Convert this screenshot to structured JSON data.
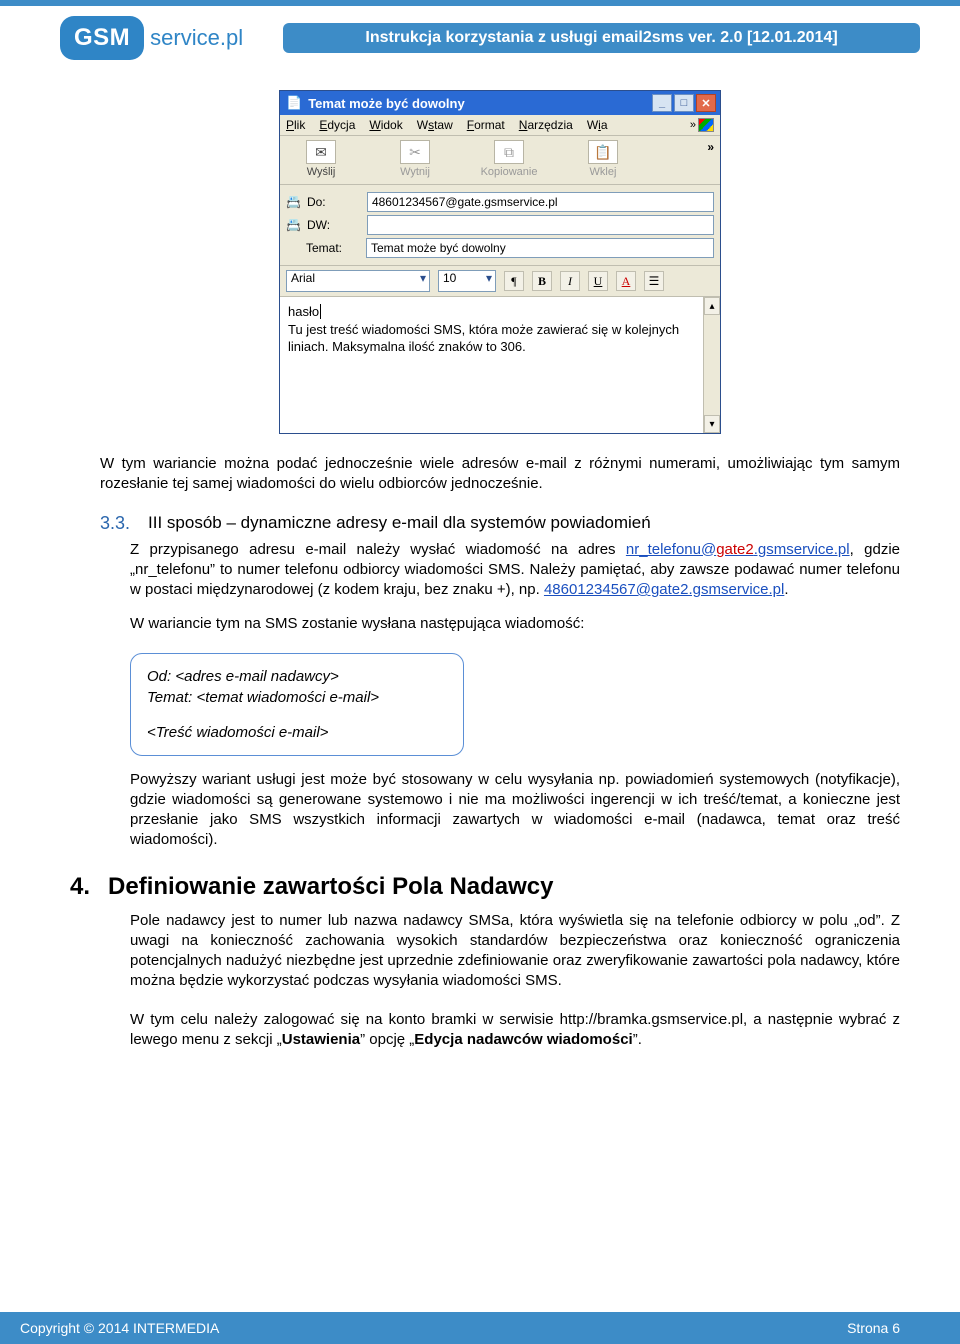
{
  "header": {
    "logo_badge": "GSM",
    "logo_suffix": "service.pl",
    "title": "Instrukcja korzystania z usługi email2sms ver. 2.0 [12.01.2014]"
  },
  "mailwin": {
    "title": "Temat może być dowolny",
    "menu": {
      "plik": "Plik",
      "edycja": "Edycja",
      "widok": "Widok",
      "wstaw": "Wstaw",
      "format": "Format",
      "narzedzia": "Narzędzia",
      "wia": "Wia",
      "chev": "»"
    },
    "toolbar": {
      "send": "Wyślij",
      "cut": "Wytnij",
      "copy": "Kopiowanie",
      "paste": "Wklej",
      "chev": "»"
    },
    "fields": {
      "to_label": "Do:",
      "to_value": "48601234567@gate.gsmservice.pl",
      "cc_label": "DW:",
      "cc_value": "",
      "subject_label": "Temat:",
      "subject_value": "Temat może być dowolny"
    },
    "format": {
      "font": "Arial",
      "size": "10"
    },
    "body_line1": "hasło",
    "body_line2": "Tu jest treść wiadomości SMS, która może zawierać się w kolejnych liniach. Maksymalna ilość znaków to 306."
  },
  "p_after_screenshot": "W tym wariancie można podać jednocześnie wiele adresów e-mail z różnymi numerami, umożliwiając tym samym rozesłanie tej samej wiadomości do wielu odbiorców jednocześnie.",
  "sec33": {
    "num": "3.3.",
    "title": "III sposób – dynamiczne adresy e-mail dla systemów powiadomień",
    "body_before": "Z przypisanego adresu e-mail należy wysłać wiadomość na adres ",
    "link1_pre": "nr_telefonu@",
    "link1_red": "gate2",
    "link1_post": ".gsmservice.pl",
    "body_mid": ", gdzie „nr_telefonu” to numer telefonu odbiorcy wiadomości SMS. Należy pamiętać, aby zawsze podawać numer telefonu w postaci międzynarodowej (z kodem kraju, bez znaku +), np. ",
    "link2": "48601234567@gate2.gsmservice.pl",
    "body_after": ".",
    "p2": "W wariancie tym na SMS zostanie wysłana następująca wiadomość:",
    "box_l1": "Od: <adres e-mail nadawcy>",
    "box_l2": "Temat: <temat wiadomości e-mail>",
    "box_l3": "<Treść wiadomości e-mail>",
    "p3": "Powyższy wariant usługi jest może być stosowany w celu wysyłania np. powiadomień systemowych (notyfikacje), gdzie wiadomości są generowane systemowo i nie ma możliwości ingerencji w ich treść/temat, a konieczne jest przesłanie jako SMS wszystkich informacji zawartych w wiadomości e-mail (nadawca, temat oraz treść wiadomości)."
  },
  "sec4": {
    "num": "4.",
    "title": "Definiowanie zawartości Pola Nadawcy",
    "p1": "Pole nadawcy jest to numer lub nazwa nadawcy SMSa, która wyświetla się na telefonie odbiorcy w polu „od”. Z uwagi na konieczność zachowania wysokich standardów bezpieczeństwa oraz konieczność ograniczenia potencjalnych nadużyć niezbędne jest uprzednie zdefiniowanie oraz zweryfikowanie zawartości pola nadawcy, które można będzie wykorzystać podczas wysyłania wiadomości SMS.",
    "p2_a": "W tym celu należy zalogować się na konto bramki w serwisie http://bramka.gsmservice.pl, a następnie wybrać z lewego menu z sekcji „",
    "p2_b": "Ustawienia",
    "p2_c": "” opcję „",
    "p2_d": "Edycja nadawców wiadomości",
    "p2_e": "”."
  },
  "footer": {
    "left": "Copyright © 2014 INTERMEDIA",
    "right": "Strona 6"
  }
}
